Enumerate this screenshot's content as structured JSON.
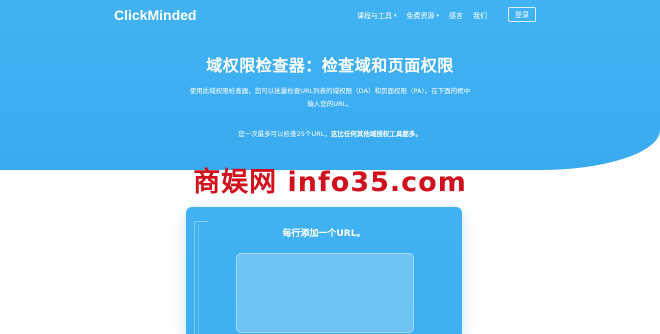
{
  "nav": {
    "logo": "ClickMinded",
    "links": [
      {
        "label": "课程与工具",
        "dropdown": true
      },
      {
        "label": "免费资源",
        "dropdown": true
      },
      {
        "label": "感言",
        "dropdown": false
      },
      {
        "label": "我们",
        "dropdown": false
      }
    ],
    "login_label": "登录"
  },
  "hero": {
    "title": "域权限检查器：检查域和页面权限",
    "description": "使用此域权限检查器，您可以批量检查URL列表的域权限（DA）和页面权限（PA）。在下面的框中输入您的URL。",
    "limit_text": "您一次最多可以检查25个URL，",
    "limit_bold": "这比任何其他域授权工具都多。"
  },
  "watermark": "商娱网 info35.com",
  "card": {
    "title": "每行添加一个URL。",
    "textarea_value": ""
  },
  "colors": {
    "hero_blue": "#41b3f3",
    "watermark_red": "#d0111d"
  }
}
